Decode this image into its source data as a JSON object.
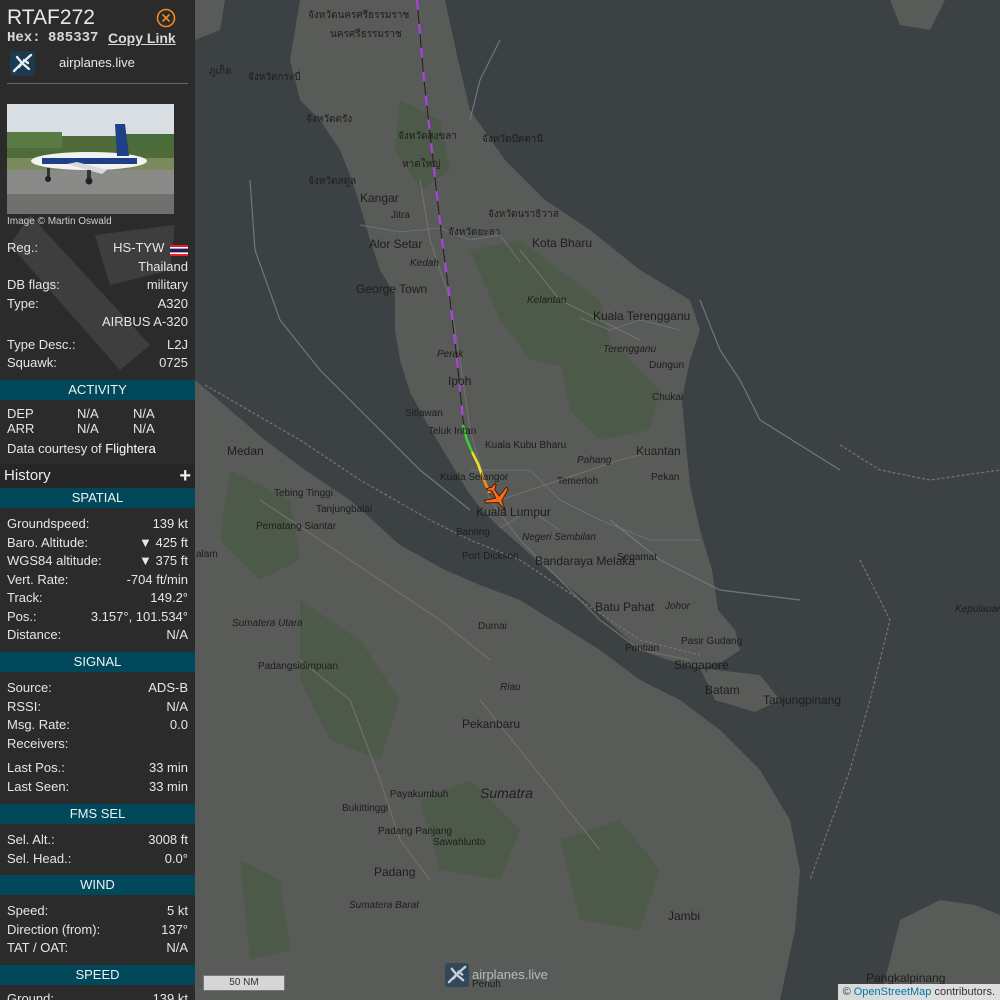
{
  "aircraft": {
    "callsign": "RTAF272",
    "hex_label": "Hex:",
    "hex": "885337",
    "copy_link": "Copy Link",
    "site_name": "airplanes.live",
    "photo_credit": "Image © Martin Oswald"
  },
  "details": [
    {
      "label": "Reg.:",
      "value": "HS-TYW"
    },
    {
      "label": "",
      "value": "Thailand"
    },
    {
      "label": "DB flags:",
      "value": "military"
    },
    {
      "label": "Type:",
      "value": "A320"
    },
    {
      "label": "",
      "value": "AIRBUS A-320"
    },
    {
      "label": "Type Desc.:",
      "value": "L2J"
    },
    {
      "label": "Squawk:",
      "value": "0725"
    }
  ],
  "activity": {
    "title": "ACTIVITY",
    "rows": [
      {
        "label": "DEP",
        "a": "N/A",
        "b": "N/A"
      },
      {
        "label": "ARR",
        "a": "N/A",
        "b": "N/A"
      }
    ],
    "courtesy_prefix": "Data courtesy of",
    "courtesy_source": "Flightera"
  },
  "history": {
    "label": "History",
    "add": "+"
  },
  "spatial": {
    "title": "SPATIAL",
    "rows": [
      {
        "label": "Groundspeed:",
        "value": "139 kt"
      },
      {
        "label": "Baro. Altitude:",
        "value": "▼ 425 ft"
      },
      {
        "label": "WGS84 altitude:",
        "value": "▼ 375 ft"
      },
      {
        "label": "Vert. Rate:",
        "value": "-704 ft/min"
      },
      {
        "label": "Track:",
        "value": "149.2°"
      },
      {
        "label": "Pos.:",
        "value": "3.157°, 101.534°"
      },
      {
        "label": "Distance:",
        "value": "N/A"
      }
    ]
  },
  "signal": {
    "title": "SIGNAL",
    "rows": [
      {
        "label": "Source:",
        "value": "ADS-B"
      },
      {
        "label": "RSSI:",
        "value": "N/A"
      },
      {
        "label": "Msg. Rate:",
        "value": "0.0"
      },
      {
        "label": "Receivers:",
        "value": ""
      },
      {
        "label": "Last Pos.:",
        "value": "33 min"
      },
      {
        "label": "Last Seen:",
        "value": "33 min"
      }
    ]
  },
  "fms": {
    "title": "FMS SEL",
    "rows": [
      {
        "label": "Sel. Alt.:",
        "value": "3008 ft"
      },
      {
        "label": "Sel. Head.:",
        "value": "0.0°"
      }
    ]
  },
  "wind": {
    "title": "WIND",
    "rows": [
      {
        "label": "Speed:",
        "value": "5 kt"
      },
      {
        "label": "Direction (from):",
        "value": "137°"
      },
      {
        "label": "TAT / OAT:",
        "value": "N/A"
      }
    ]
  },
  "speed": {
    "title": "SPEED",
    "rows": [
      {
        "label": "Ground:",
        "value": "139 kt"
      }
    ]
  },
  "map": {
    "scale": "50 NM",
    "watermark": "airplanes.live",
    "attribution_prefix": "©",
    "attribution_link": "OpenStreetMap",
    "attribution_suffix": "contributors.",
    "labels": {
      "kangar": "Kangar",
      "jitra": "Jitra",
      "alor_setar": "Alor Setar",
      "kedah": "Kedah",
      "george_town": "George Town",
      "kota_bharu": "Kota Bharu",
      "kelantan": "Kelantan",
      "kuala_terengganu": "Kuala Terengganu",
      "terengganu": "Terengganu",
      "dungun": "Dungun",
      "perak": "Perak",
      "ipoh": "Ipoh",
      "chukai": "Chukai",
      "sitiawan": "Sitiawan",
      "teluk_intan": "Teluk Intan",
      "kuala_kubu_bharu": "Kuala Kubu Bharu",
      "pahang": "Pahang",
      "kuantan": "Kuantan",
      "medan": "Medan",
      "kuala_selangor": "Kuala Selangor",
      "temerloh": "Temerloh",
      "pekan": "Pekan",
      "tebing_tinggi": "Tebing Tinggi",
      "tanjungbalai": "Tanjungbalai",
      "kuala_lumpur": "Kuala Lumpur",
      "banting": "Banting",
      "negeri_sembilan": "Negeri Sembilan",
      "pematang_siantar": "Pematang Siantar",
      "port_dickson": "Port Dickson",
      "segamat": "Segamat",
      "bandaraya_melaka": "Bandaraya Melaka",
      "batu_pahat": "Batu Pahat",
      "johor": "Johor",
      "sumatera_utara": "Sumatera Utara",
      "dumai": "Dumai",
      "pasir_gudang": "Pasir Gudang",
      "pontian": "Pontian",
      "kepulauan_riau": "Kepulauan Riau",
      "singapore": "Singapore",
      "padangsidimpuan": "Padangsidimpuan",
      "batam": "Batam",
      "tanjungpinang": "Tanjungpinang",
      "riau": "Riau",
      "pekanbaru": "Pekanbaru",
      "payakumbuh": "Payakumbuh",
      "sumatra": "Sumatra",
      "bukittinggi": "Bukittinggi",
      "padang_panjang": "Padang Panjang",
      "sawahlunto": "Sawahlunto",
      "padang": "Padang",
      "sumatera_barat": "Sumatera Barat",
      "jambi": "Jambi",
      "pangkalpinang": "Pangkalpinang",
      "penuh": "Penuh",
      "alam": "alam",
      "th1": "จังหวัดนครศรีธรรมราช",
      "th2": "นครศรีธรรมราช",
      "th3": "จังหวัดกระบี่",
      "th4": "ภูเก็ต",
      "th5": "จังหวัดตรัง",
      "th6": "จังหวัดสงขลา",
      "th7": "จังหวัดปัตตานี",
      "th8": "หาดใหญ่",
      "th9": "จังหวัดสตูล",
      "th10": "จังหวัดนราธิวาส",
      "th11": "จังหวัดยะลา"
    }
  },
  "colors": {
    "sidebar_bg": "#2b2b2b",
    "section_bg": "#00485a",
    "water": "#3c4144",
    "land": "#585b57",
    "forest": "#4e5a49",
    "aircraft_icon": "#ff6a1a",
    "track_purple": "#b13fe0"
  }
}
